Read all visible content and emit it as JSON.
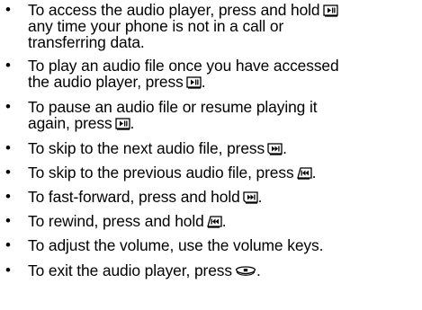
{
  "bullets": [
    {
      "lines": [
        "To access the audio player, press and hold",
        "any time your phone is not in a call or",
        "transferring data."
      ],
      "key_icon": "play-pause-key-icon",
      "key_on_line": 0
    },
    {
      "lines": [
        "To play an audio file once you have accessed",
        "the audio player, press",
        "."
      ],
      "key_icon": "play-pause-key-icon"
    },
    {
      "lines": [
        "To pause an audio file or resume playing it",
        "again, press",
        "."
      ],
      "key_icon": "play-pause-key-icon"
    },
    {
      "lines": [
        "To skip to the next audio file, press",
        "."
      ],
      "key_icon": "next-track-key-icon"
    },
    {
      "lines": [
        "To skip to the previous audio file, press",
        "."
      ],
      "key_icon": "previous-track-key-icon"
    },
    {
      "lines": [
        "To fast-forward, press and hold",
        "."
      ],
      "key_icon": "next-track-key-icon"
    },
    {
      "lines": [
        "To rewind, press and hold",
        "."
      ],
      "key_icon": "previous-track-key-icon"
    },
    {
      "lines": [
        "To adjust the volume, use the volume keys."
      ]
    },
    {
      "lines": [
        "To exit the audio player, press",
        "."
      ],
      "key_icon": "end-key-icon"
    }
  ],
  "bullet_glyph": "•"
}
